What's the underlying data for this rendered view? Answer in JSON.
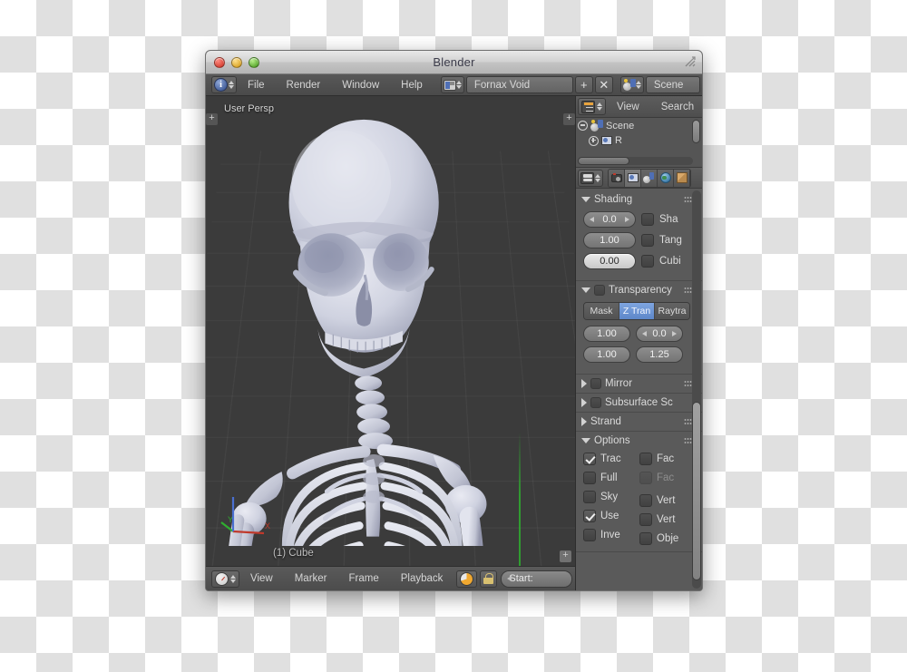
{
  "window": {
    "title": "Blender",
    "controls": {
      "close": "close",
      "minimize": "minimize",
      "maximize": "maximize"
    }
  },
  "topbar": {
    "editor_icon": "info-icon",
    "menus": [
      "File",
      "Render",
      "Window",
      "Help"
    ],
    "layout_icon": "screen-layout-icon",
    "layout_name": "Fornax Void",
    "add_button": "+",
    "remove_button": "✕",
    "scene_icon": "scene-icon",
    "scene_name": "Scene"
  },
  "viewport": {
    "view_label": "User Persp",
    "object_label": "(1) Cube",
    "axis_labels": {
      "x": "X",
      "y": "Y",
      "z": "Z"
    },
    "background_color": "#3b3b3b",
    "grid_color": "#4a4a4a",
    "y_axis_color": "#2fae2f",
    "x_axis_color": "#c0392b",
    "z_axis_color": "#4a6fd0",
    "model_color": "#c9cbd8"
  },
  "timeline": {
    "editor_icon": "clock-icon",
    "menus": [
      "View",
      "Marker",
      "Frame",
      "Playback"
    ],
    "autokey_icon": "record-pie-icon",
    "lock_icon": "lock-icon",
    "start_label": "Start:"
  },
  "outliner": {
    "editor_icon": "outliner-icon",
    "menus": [
      "View",
      "Search"
    ],
    "rows": [
      {
        "label": "Scene",
        "icon": "scene-icon",
        "expander": "minus",
        "indent": 0
      },
      {
        "label": "R",
        "icon": "renderlayer-icon",
        "expander": "plus",
        "indent": 1
      }
    ]
  },
  "properties": {
    "editor_icon": "properties-icon",
    "tabs": [
      {
        "name": "render-tab",
        "icon": "camera-icon",
        "active": false
      },
      {
        "name": "render-layers-tab",
        "icon": "images-icon",
        "active": true
      },
      {
        "name": "scene-tab",
        "icon": "scene-icon",
        "active": false
      },
      {
        "name": "world-tab",
        "icon": "world-icon",
        "active": false
      },
      {
        "name": "object-tab",
        "icon": "cube-icon",
        "active": false
      }
    ],
    "panels": {
      "shading": {
        "title": "Shading",
        "open": true,
        "fields": [
          {
            "value": "0.0",
            "arrows": true,
            "active": false
          },
          {
            "value": "1.00",
            "arrows": false,
            "active": false
          },
          {
            "value": "0.00",
            "arrows": false,
            "active": true
          }
        ],
        "checks": [
          {
            "label": "Sha",
            "checked": false
          },
          {
            "label": "Tang",
            "checked": false
          },
          {
            "label": "Cubi",
            "checked": false
          }
        ]
      },
      "transparency": {
        "title": "Transparency",
        "open": true,
        "enabled": false,
        "modes": [
          {
            "label": "Mask",
            "selected": false
          },
          {
            "label": "Z Tran",
            "selected": true
          },
          {
            "label": "Raytra",
            "selected": false
          }
        ],
        "fields": [
          {
            "value": "1.00",
            "arrows": false
          },
          {
            "value": "0.0",
            "arrows": true
          },
          {
            "value": "1.00",
            "arrows": false
          },
          {
            "value": "1.25",
            "arrows": false
          }
        ]
      },
      "mirror": {
        "title": "Mirror",
        "open": false,
        "enabled": false
      },
      "subsurface": {
        "title": "Subsurface Sc",
        "open": false,
        "enabled": false
      },
      "strand": {
        "title": "Strand",
        "open": false
      },
      "options": {
        "title": "Options",
        "open": true,
        "left_checks": [
          {
            "label": "Trac",
            "checked": true,
            "dim": false
          },
          {
            "label": "Full",
            "checked": false,
            "dim": false
          },
          {
            "label": "Sky",
            "checked": false,
            "dim": false
          },
          {
            "label": "Use",
            "checked": true,
            "dim": false
          },
          {
            "label": "Inve",
            "checked": false,
            "dim": false
          }
        ],
        "right_checks": [
          {
            "label": "Fac",
            "checked": false,
            "dim": false
          },
          {
            "label": "Fac",
            "checked": false,
            "dim": true
          },
          {
            "label": "Vert",
            "checked": false,
            "dim": false
          },
          {
            "label": "Vert",
            "checked": false,
            "dim": false
          },
          {
            "label": "Obje",
            "checked": false,
            "dim": false
          }
        ]
      }
    }
  }
}
